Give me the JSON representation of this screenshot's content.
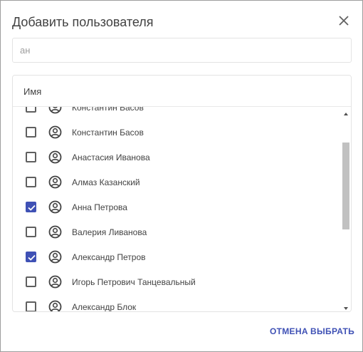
{
  "dialog": {
    "title": "Добавить пользователя",
    "close_icon": "close-icon"
  },
  "search": {
    "value": "ан"
  },
  "list": {
    "header": "Имя",
    "users": [
      {
        "name": "Константин Басов",
        "checked": false
      },
      {
        "name": "Константин Басов",
        "checked": false
      },
      {
        "name": "Анастасия Иванова",
        "checked": false
      },
      {
        "name": "Алмаз Казанский",
        "checked": false
      },
      {
        "name": "Анна Петрова",
        "checked": true
      },
      {
        "name": "Валерия Ливанова",
        "checked": false
      },
      {
        "name": "Александр Петров",
        "checked": true
      },
      {
        "name": "Игорь Петрович Танцевальный",
        "checked": false
      },
      {
        "name": "Александр Блок",
        "checked": false
      }
    ]
  },
  "actions": {
    "cancel_label": "ОТМЕНА",
    "select_label": "ВЫБРАТЬ"
  },
  "colors": {
    "accent": "#3f51b5",
    "scroll_thumb": "#c1c1c1"
  }
}
